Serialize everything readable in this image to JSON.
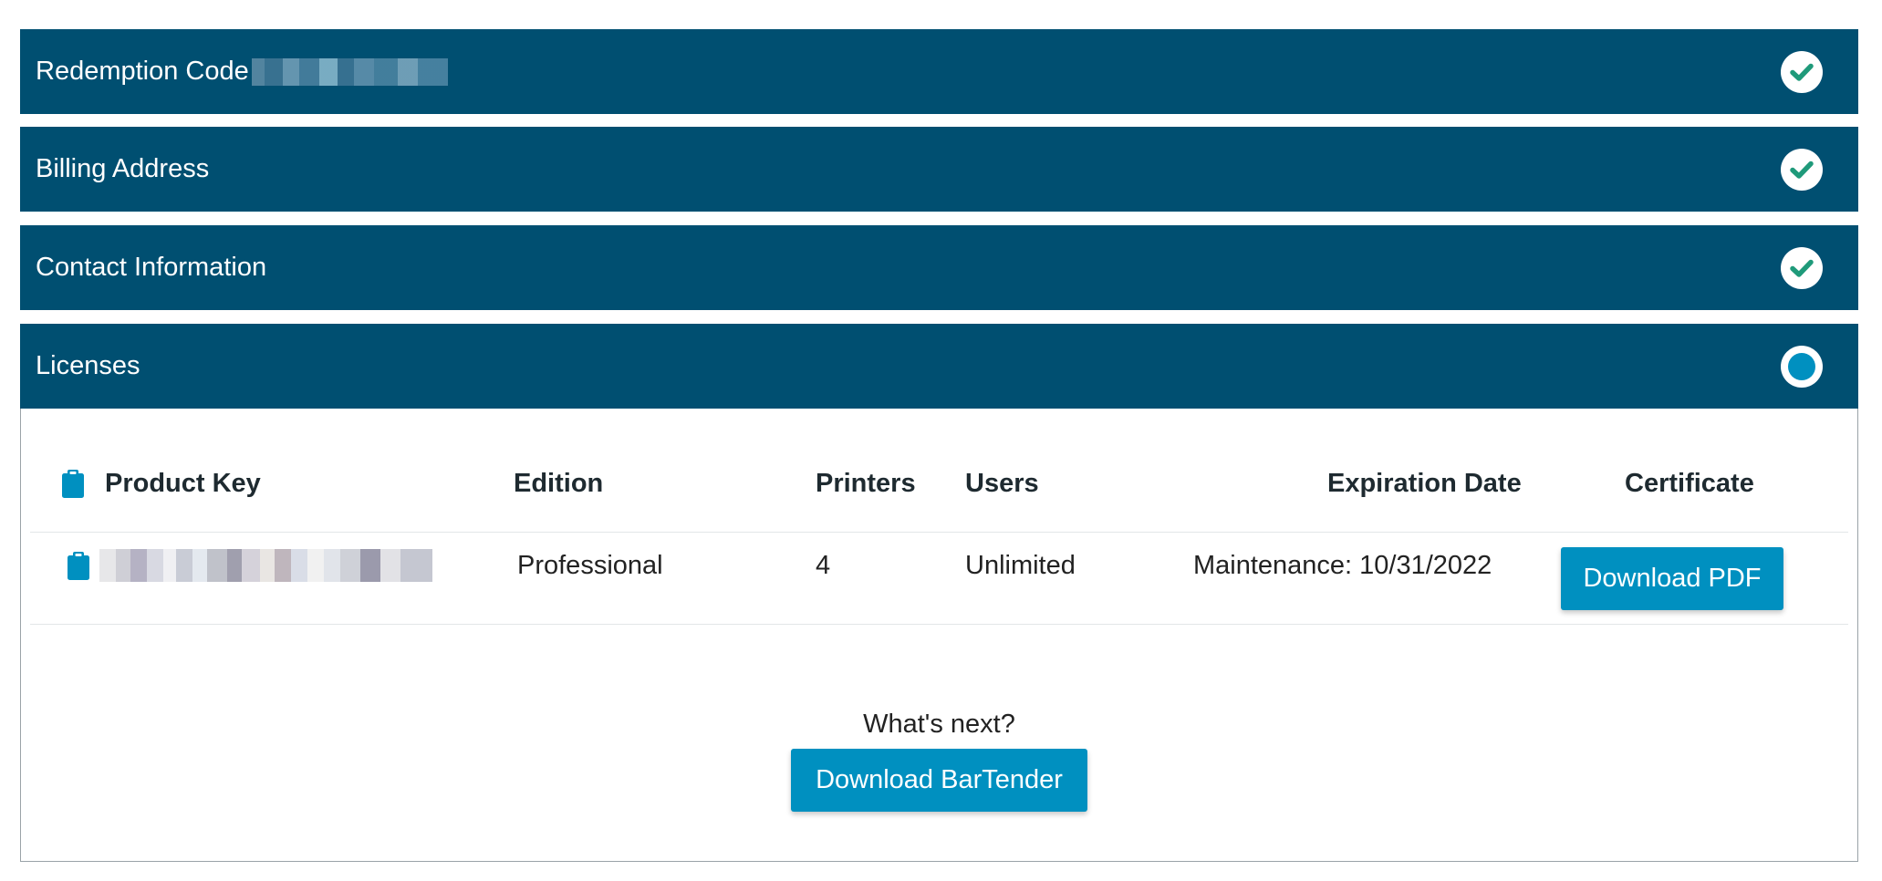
{
  "panels": [
    {
      "title": "Redemption Code",
      "status": "complete",
      "status_icon": "check-circle-icon"
    },
    {
      "title": "Billing Address",
      "status": "complete",
      "status_icon": "check-circle-icon"
    },
    {
      "title": "Contact Information",
      "status": "complete",
      "status_icon": "check-circle-icon"
    },
    {
      "title": "Licenses",
      "status": "in-progress",
      "status_icon": "ring-circle-icon"
    }
  ],
  "licenses": {
    "headers": {
      "product_key": "Product Key",
      "edition": "Edition",
      "printers": "Printers",
      "users": "Users",
      "expiration": "Expiration Date",
      "certificate": "Certificate"
    },
    "rows": [
      {
        "edition": "Professional",
        "printers": "4",
        "users": "Unlimited",
        "expiration": "Maintenance: 10/31/2022",
        "certificate_button": "Download PDF"
      }
    ],
    "whats_next": "What's next?",
    "download_button": "Download BarTender"
  },
  "colors": {
    "header_bg": "#004f71",
    "accent": "#0090c0",
    "check": "#1f9a7a"
  }
}
